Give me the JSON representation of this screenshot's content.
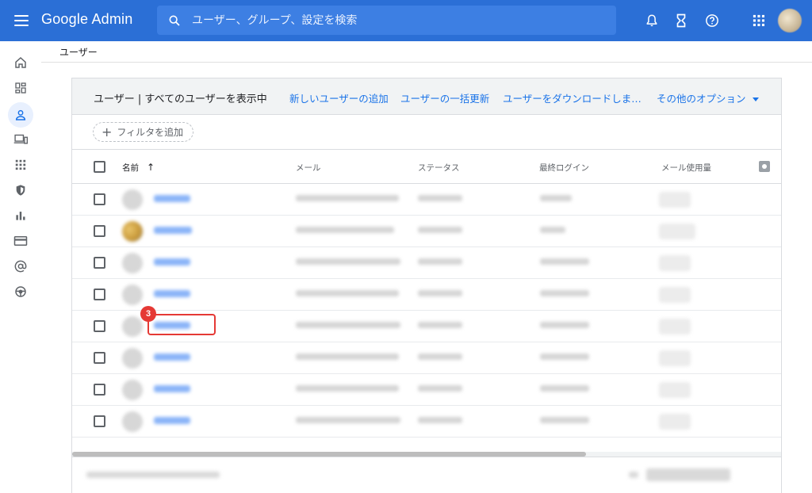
{
  "app": {
    "title": "Google Admin"
  },
  "search": {
    "placeholder": "ユーザー、グループ、設定を検索"
  },
  "breadcrumb": {
    "label": "ユーザー"
  },
  "header": {
    "title": "ユーザー | すべてのユーザーを表示中",
    "actions": [
      {
        "label": "新しいユーザーの追加"
      },
      {
        "label": "ユーザーの一括更新"
      },
      {
        "label": "ユーザーをダウンロードしま…"
      },
      {
        "label": "その他のオプション"
      }
    ]
  },
  "filter": {
    "label": "フィルタを追加"
  },
  "table": {
    "columns": [
      "名前",
      "メール",
      "ステータス",
      "最終ログイン",
      "メール使用量"
    ],
    "sort_indicator": "↑",
    "row_count": 8
  },
  "annotation": {
    "badge": "3",
    "color": "#e53935"
  },
  "colors": {
    "topbar": "#2b6fd6",
    "accent": "#1a73e8"
  },
  "icons": {
    "topbar": [
      "menu-icon",
      "search-icon",
      "bell-icon",
      "hourglass-icon",
      "help-icon",
      "apps-icon"
    ],
    "rail": [
      "home-icon",
      "dashboard-icon",
      "user-icon",
      "devices-icon",
      "apps-grid-icon",
      "shield-icon",
      "bar-chart-icon",
      "billing-icon",
      "at-sign-icon",
      "steering-icon"
    ]
  }
}
